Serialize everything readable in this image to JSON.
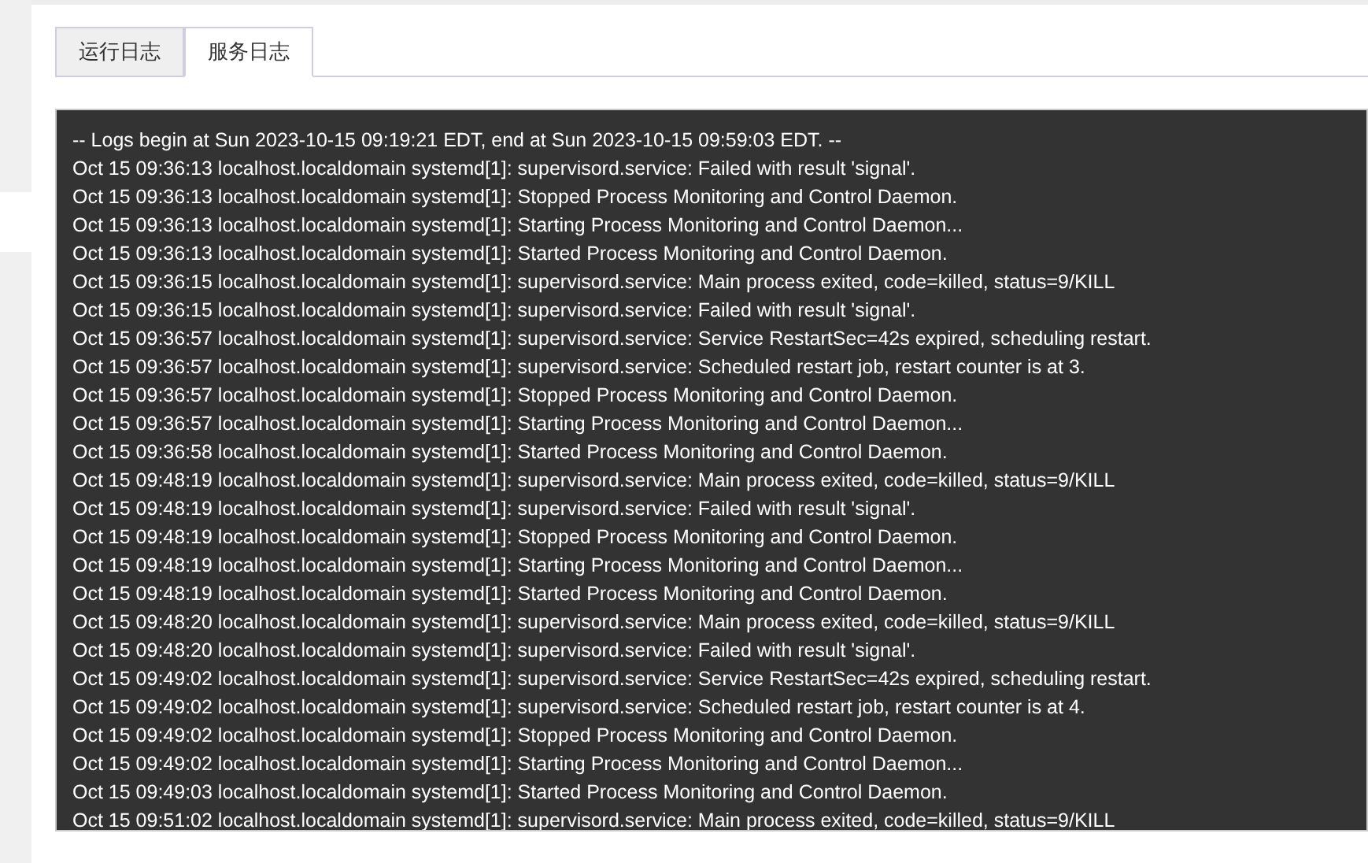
{
  "tabs": [
    {
      "label": "运行日志",
      "selected": false
    },
    {
      "label": "服务日志",
      "selected": true
    }
  ],
  "log_lines": [
    "-- Logs begin at Sun 2023-10-15 09:19:21 EDT, end at Sun 2023-10-15 09:59:03 EDT. --",
    "Oct 15 09:36:13 localhost.localdomain systemd[1]: supervisord.service: Failed with result 'signal'.",
    "Oct 15 09:36:13 localhost.localdomain systemd[1]: Stopped Process Monitoring and Control Daemon.",
    "Oct 15 09:36:13 localhost.localdomain systemd[1]: Starting Process Monitoring and Control Daemon...",
    "Oct 15 09:36:13 localhost.localdomain systemd[1]: Started Process Monitoring and Control Daemon.",
    "Oct 15 09:36:15 localhost.localdomain systemd[1]: supervisord.service: Main process exited, code=killed, status=9/KILL",
    "Oct 15 09:36:15 localhost.localdomain systemd[1]: supervisord.service: Failed with result 'signal'.",
    "Oct 15 09:36:57 localhost.localdomain systemd[1]: supervisord.service: Service RestartSec=42s expired, scheduling restart.",
    "Oct 15 09:36:57 localhost.localdomain systemd[1]: supervisord.service: Scheduled restart job, restart counter is at 3.",
    "Oct 15 09:36:57 localhost.localdomain systemd[1]: Stopped Process Monitoring and Control Daemon.",
    "Oct 15 09:36:57 localhost.localdomain systemd[1]: Starting Process Monitoring and Control Daemon...",
    "Oct 15 09:36:58 localhost.localdomain systemd[1]: Started Process Monitoring and Control Daemon.",
    "Oct 15 09:48:19 localhost.localdomain systemd[1]: supervisord.service: Main process exited, code=killed, status=9/KILL",
    "Oct 15 09:48:19 localhost.localdomain systemd[1]: supervisord.service: Failed with result 'signal'.",
    "Oct 15 09:48:19 localhost.localdomain systemd[1]: Stopped Process Monitoring and Control Daemon.",
    "Oct 15 09:48:19 localhost.localdomain systemd[1]: Starting Process Monitoring and Control Daemon...",
    "Oct 15 09:48:19 localhost.localdomain systemd[1]: Started Process Monitoring and Control Daemon.",
    "Oct 15 09:48:20 localhost.localdomain systemd[1]: supervisord.service: Main process exited, code=killed, status=9/KILL",
    "Oct 15 09:48:20 localhost.localdomain systemd[1]: supervisord.service: Failed with result 'signal'.",
    "Oct 15 09:49:02 localhost.localdomain systemd[1]: supervisord.service: Service RestartSec=42s expired, scheduling restart.",
    "Oct 15 09:49:02 localhost.localdomain systemd[1]: supervisord.service: Scheduled restart job, restart counter is at 4.",
    "Oct 15 09:49:02 localhost.localdomain systemd[1]: Stopped Process Monitoring and Control Daemon.",
    "Oct 15 09:49:02 localhost.localdomain systemd[1]: Starting Process Monitoring and Control Daemon...",
    "Oct 15 09:49:03 localhost.localdomain systemd[1]: Started Process Monitoring and Control Daemon.",
    "Oct 15 09:51:02 localhost.localdomain systemd[1]: supervisord.service: Main process exited, code=killed, status=9/KILL"
  ]
}
